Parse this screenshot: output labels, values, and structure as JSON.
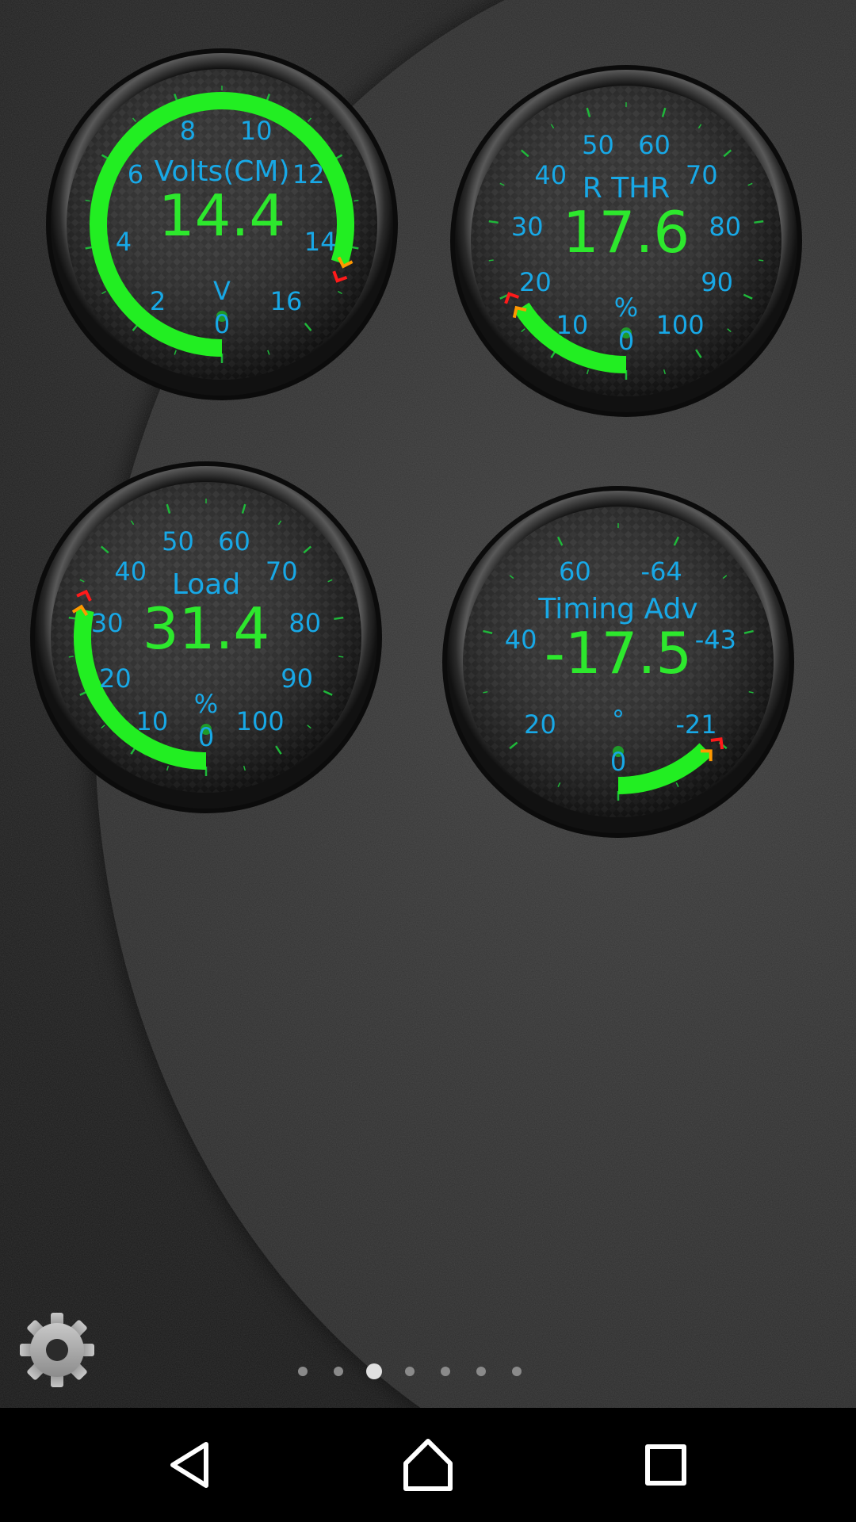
{
  "gauges": [
    {
      "id": "volts",
      "title": "Volts(CM)",
      "value": "14.4",
      "unit": "V",
      "min": 0,
      "max": 18,
      "reading": 14.4,
      "tick_labels": [
        {
          "v": 0,
          "text": "0"
        },
        {
          "v": 2,
          "text": "2"
        },
        {
          "v": 4,
          "text": "4"
        },
        {
          "v": 6,
          "text": "6"
        },
        {
          "v": 8,
          "text": "8"
        },
        {
          "v": 10,
          "text": "10"
        },
        {
          "v": 12,
          "text": "12"
        },
        {
          "v": 14,
          "text": "14"
        },
        {
          "v": 16,
          "text": "16"
        }
      ]
    },
    {
      "id": "r-thr",
      "title": "R THR",
      "value": "17.6",
      "unit": "%",
      "min": 0,
      "max": 110,
      "reading": 17.6,
      "tick_labels": [
        {
          "v": 0,
          "text": "0"
        },
        {
          "v": 10,
          "text": "10"
        },
        {
          "v": 20,
          "text": "20"
        },
        {
          "v": 30,
          "text": "30"
        },
        {
          "v": 40,
          "text": "40"
        },
        {
          "v": 50,
          "text": "50"
        },
        {
          "v": 60,
          "text": "60"
        },
        {
          "v": 70,
          "text": "70"
        },
        {
          "v": 80,
          "text": "80"
        },
        {
          "v": 90,
          "text": "90"
        },
        {
          "v": 100,
          "text": "100"
        }
      ]
    },
    {
      "id": "load",
      "title": "Load",
      "value": "31.4",
      "unit": "%",
      "min": 0,
      "max": 110,
      "reading": 31.4,
      "tick_labels": [
        {
          "v": 0,
          "text": "0"
        },
        {
          "v": 10,
          "text": "10"
        },
        {
          "v": 20,
          "text": "20"
        },
        {
          "v": 30,
          "text": "30"
        },
        {
          "v": 40,
          "text": "40"
        },
        {
          "v": 50,
          "text": "50"
        },
        {
          "v": 60,
          "text": "60"
        },
        {
          "v": 70,
          "text": "70"
        },
        {
          "v": 80,
          "text": "80"
        },
        {
          "v": 90,
          "text": "90"
        },
        {
          "v": 100,
          "text": "100"
        }
      ]
    },
    {
      "id": "timing-adv",
      "title": "Timing Adv",
      "value": "-17.5",
      "unit": "°",
      "min": 0,
      "max": 140,
      "reading": -17.5,
      "tick_labels": [
        {
          "v": 0,
          "text": "0"
        },
        {
          "v": 20,
          "text": "20"
        },
        {
          "v": 40,
          "text": "40"
        },
        {
          "v": 60,
          "text": "60"
        },
        {
          "v": 80,
          "text": "-64"
        },
        {
          "v": 100,
          "text": "-43"
        },
        {
          "v": 120,
          "text": "-21"
        }
      ]
    }
  ],
  "pager": {
    "count": 7,
    "active": 3
  },
  "colors": {
    "bar": "#22ee22",
    "label": "#18a8e6",
    "value": "#2de82d",
    "tick": "#1fb83a",
    "warn": "#ff9800",
    "alarm": "#ff1a1a"
  },
  "icons": {
    "settings": "gear-icon",
    "back": "back-triangle-icon",
    "home": "home-icon",
    "recents": "recents-square-icon"
  }
}
